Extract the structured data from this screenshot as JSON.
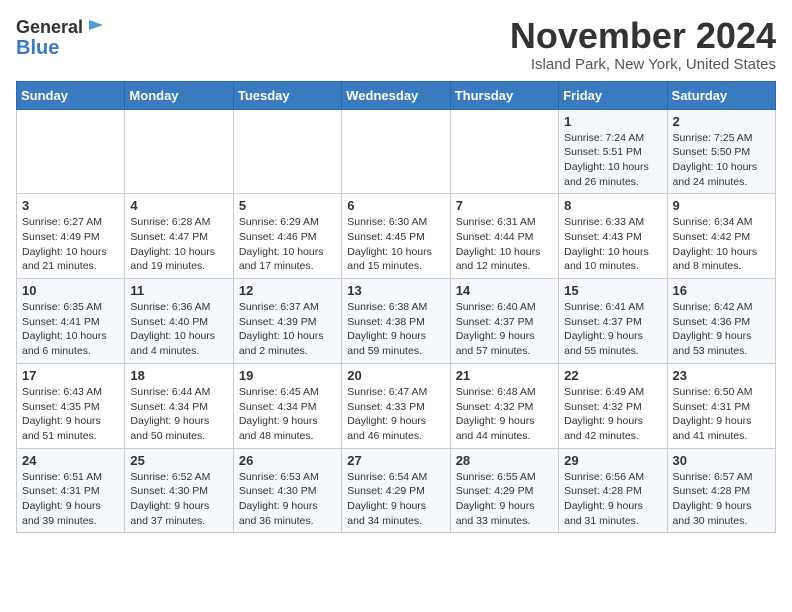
{
  "header": {
    "logo_line1": "General",
    "logo_line2": "Blue",
    "month": "November 2024",
    "location": "Island Park, New York, United States"
  },
  "days_of_week": [
    "Sunday",
    "Monday",
    "Tuesday",
    "Wednesday",
    "Thursday",
    "Friday",
    "Saturday"
  ],
  "weeks": [
    [
      {
        "day": "",
        "info": ""
      },
      {
        "day": "",
        "info": ""
      },
      {
        "day": "",
        "info": ""
      },
      {
        "day": "",
        "info": ""
      },
      {
        "day": "",
        "info": ""
      },
      {
        "day": "1",
        "info": "Sunrise: 7:24 AM\nSunset: 5:51 PM\nDaylight: 10 hours and 26 minutes."
      },
      {
        "day": "2",
        "info": "Sunrise: 7:25 AM\nSunset: 5:50 PM\nDaylight: 10 hours and 24 minutes."
      }
    ],
    [
      {
        "day": "3",
        "info": "Sunrise: 6:27 AM\nSunset: 4:49 PM\nDaylight: 10 hours and 21 minutes."
      },
      {
        "day": "4",
        "info": "Sunrise: 6:28 AM\nSunset: 4:47 PM\nDaylight: 10 hours and 19 minutes."
      },
      {
        "day": "5",
        "info": "Sunrise: 6:29 AM\nSunset: 4:46 PM\nDaylight: 10 hours and 17 minutes."
      },
      {
        "day": "6",
        "info": "Sunrise: 6:30 AM\nSunset: 4:45 PM\nDaylight: 10 hours and 15 minutes."
      },
      {
        "day": "7",
        "info": "Sunrise: 6:31 AM\nSunset: 4:44 PM\nDaylight: 10 hours and 12 minutes."
      },
      {
        "day": "8",
        "info": "Sunrise: 6:33 AM\nSunset: 4:43 PM\nDaylight: 10 hours and 10 minutes."
      },
      {
        "day": "9",
        "info": "Sunrise: 6:34 AM\nSunset: 4:42 PM\nDaylight: 10 hours and 8 minutes."
      }
    ],
    [
      {
        "day": "10",
        "info": "Sunrise: 6:35 AM\nSunset: 4:41 PM\nDaylight: 10 hours and 6 minutes."
      },
      {
        "day": "11",
        "info": "Sunrise: 6:36 AM\nSunset: 4:40 PM\nDaylight: 10 hours and 4 minutes."
      },
      {
        "day": "12",
        "info": "Sunrise: 6:37 AM\nSunset: 4:39 PM\nDaylight: 10 hours and 2 minutes."
      },
      {
        "day": "13",
        "info": "Sunrise: 6:38 AM\nSunset: 4:38 PM\nDaylight: 9 hours and 59 minutes."
      },
      {
        "day": "14",
        "info": "Sunrise: 6:40 AM\nSunset: 4:37 PM\nDaylight: 9 hours and 57 minutes."
      },
      {
        "day": "15",
        "info": "Sunrise: 6:41 AM\nSunset: 4:37 PM\nDaylight: 9 hours and 55 minutes."
      },
      {
        "day": "16",
        "info": "Sunrise: 6:42 AM\nSunset: 4:36 PM\nDaylight: 9 hours and 53 minutes."
      }
    ],
    [
      {
        "day": "17",
        "info": "Sunrise: 6:43 AM\nSunset: 4:35 PM\nDaylight: 9 hours and 51 minutes."
      },
      {
        "day": "18",
        "info": "Sunrise: 6:44 AM\nSunset: 4:34 PM\nDaylight: 9 hours and 50 minutes."
      },
      {
        "day": "19",
        "info": "Sunrise: 6:45 AM\nSunset: 4:34 PM\nDaylight: 9 hours and 48 minutes."
      },
      {
        "day": "20",
        "info": "Sunrise: 6:47 AM\nSunset: 4:33 PM\nDaylight: 9 hours and 46 minutes."
      },
      {
        "day": "21",
        "info": "Sunrise: 6:48 AM\nSunset: 4:32 PM\nDaylight: 9 hours and 44 minutes."
      },
      {
        "day": "22",
        "info": "Sunrise: 6:49 AM\nSunset: 4:32 PM\nDaylight: 9 hours and 42 minutes."
      },
      {
        "day": "23",
        "info": "Sunrise: 6:50 AM\nSunset: 4:31 PM\nDaylight: 9 hours and 41 minutes."
      }
    ],
    [
      {
        "day": "24",
        "info": "Sunrise: 6:51 AM\nSunset: 4:31 PM\nDaylight: 9 hours and 39 minutes."
      },
      {
        "day": "25",
        "info": "Sunrise: 6:52 AM\nSunset: 4:30 PM\nDaylight: 9 hours and 37 minutes."
      },
      {
        "day": "26",
        "info": "Sunrise: 6:53 AM\nSunset: 4:30 PM\nDaylight: 9 hours and 36 minutes."
      },
      {
        "day": "27",
        "info": "Sunrise: 6:54 AM\nSunset: 4:29 PM\nDaylight: 9 hours and 34 minutes."
      },
      {
        "day": "28",
        "info": "Sunrise: 6:55 AM\nSunset: 4:29 PM\nDaylight: 9 hours and 33 minutes."
      },
      {
        "day": "29",
        "info": "Sunrise: 6:56 AM\nSunset: 4:28 PM\nDaylight: 9 hours and 31 minutes."
      },
      {
        "day": "30",
        "info": "Sunrise: 6:57 AM\nSunset: 4:28 PM\nDaylight: 9 hours and 30 minutes."
      }
    ]
  ]
}
